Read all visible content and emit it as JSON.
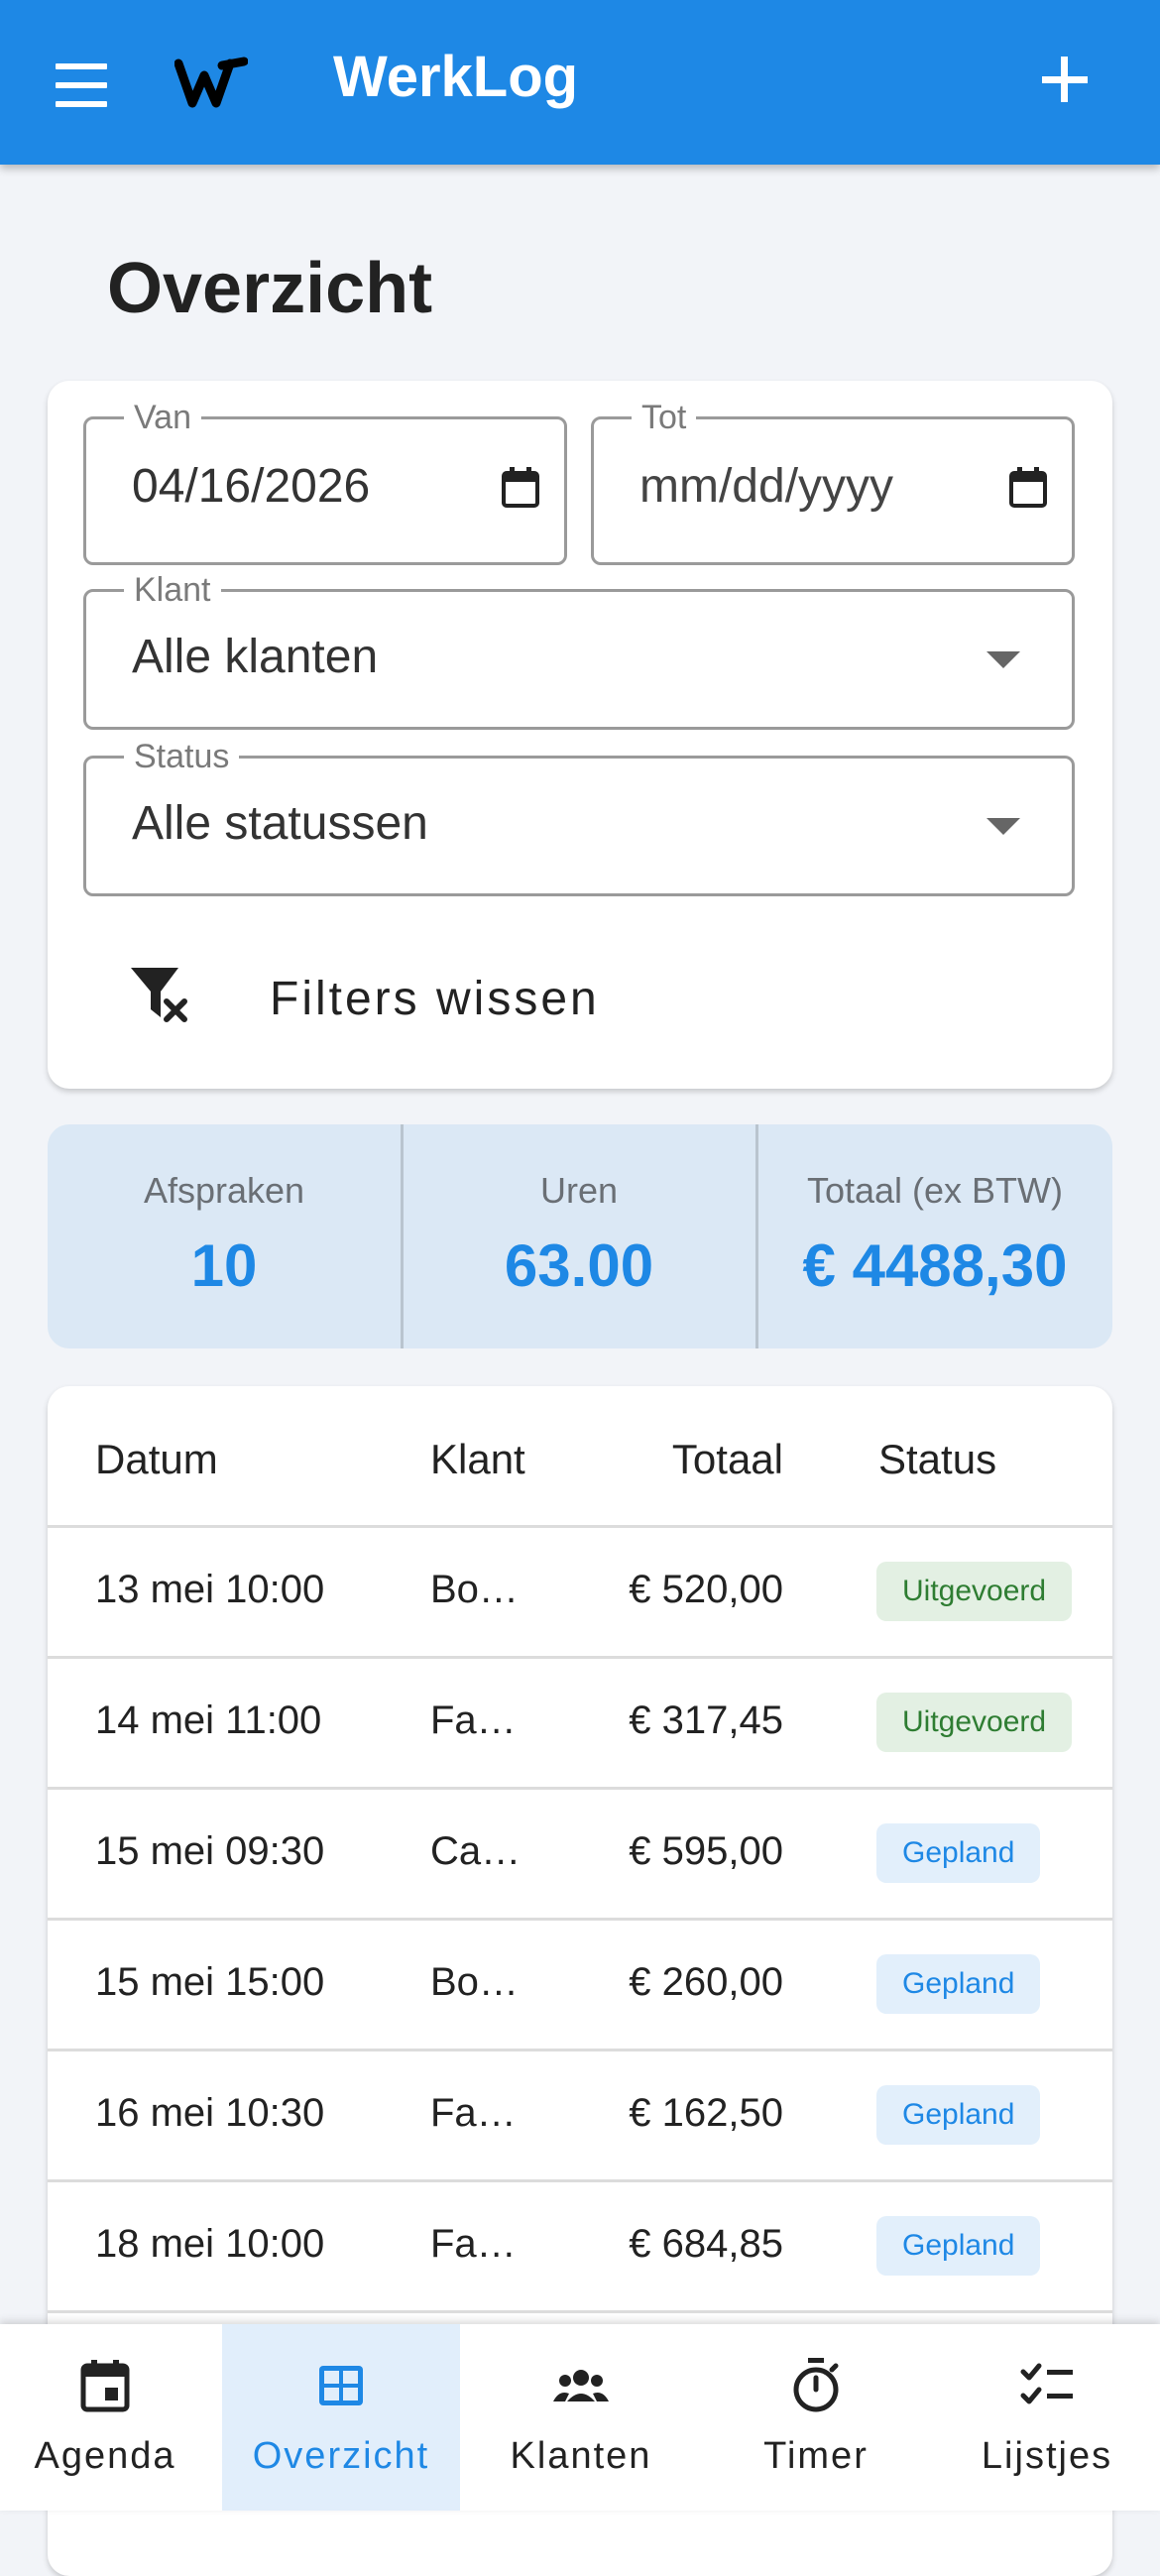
{
  "app": {
    "title": "WerkLog"
  },
  "page": {
    "title": "Overzicht"
  },
  "filters": {
    "van": {
      "label": "Van",
      "value": "04/16/2026"
    },
    "tot": {
      "label": "Tot",
      "value": "mm/dd/yyyy"
    },
    "klant": {
      "label": "Klant",
      "value": "Alle klanten"
    },
    "status": {
      "label": "Status",
      "value": "Alle statussen"
    },
    "clear_label": "Filters wissen"
  },
  "summary": {
    "afspraken": {
      "label": "Afspraken",
      "value": "10"
    },
    "uren": {
      "label": "Uren",
      "value": "63.00"
    },
    "totaal": {
      "label": "Totaal (ex BTW)",
      "value": "€ 4488,30"
    }
  },
  "table": {
    "headers": {
      "datum": "Datum",
      "klant": "Klant",
      "totaal": "Totaal",
      "status": "Status"
    },
    "rows": [
      {
        "datum": "13 mei 10:00",
        "klant": "Bo…",
        "totaal": "€ 520,00",
        "status": "Uitgevoerd",
        "status_color": "#2e7d32"
      },
      {
        "datum": "14 mei 11:00",
        "klant": "Fa…",
        "totaal": "€ 317,45",
        "status": "Uitgevoerd",
        "status_color": "#2e7d32"
      },
      {
        "datum": "15 mei 09:30",
        "klant": "Ca…",
        "totaal": "€ 595,00",
        "status": "Gepland",
        "status_color": "#1e88e5"
      },
      {
        "datum": "15 mei 15:00",
        "klant": "Bo…",
        "totaal": "€ 260,00",
        "status": "Gepland",
        "status_color": "#1e88e5"
      },
      {
        "datum": "16 mei 10:30",
        "klant": "Fa…",
        "totaal": "€ 162,50",
        "status": "Gepland",
        "status_color": "#1e88e5"
      },
      {
        "datum": "18 mei 10:00",
        "klant": "Fa…",
        "totaal": "€ 684,85",
        "status": "Gepland",
        "status_color": "#1e88e5"
      }
    ]
  },
  "nav": {
    "items": [
      {
        "label": "Agenda",
        "icon": "calendar-event-icon"
      },
      {
        "label": "Overzicht",
        "icon": "table-view-icon",
        "active": true
      },
      {
        "label": "Klanten",
        "icon": "group-icon"
      },
      {
        "label": "Timer",
        "icon": "stopwatch-icon"
      },
      {
        "label": "Lijstjes",
        "icon": "checklist-icon"
      }
    ]
  },
  "colors": {
    "primary": "#1e88e5",
    "summary_bg": "#dbe8f5",
    "active_nav_bg": "#e1eefb"
  }
}
